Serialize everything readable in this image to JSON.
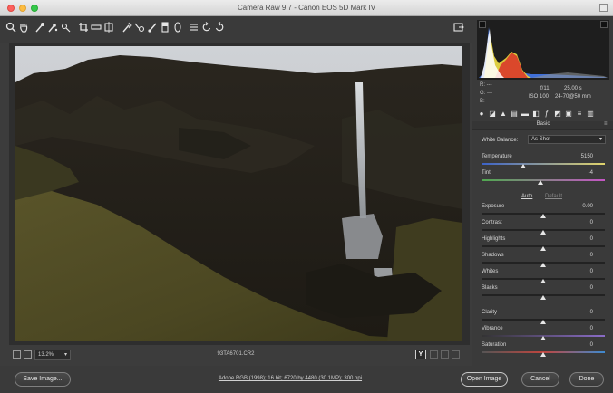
{
  "window": {
    "title": "Camera Raw 9.7  -  Canon EOS 5D Mark IV"
  },
  "toolbar": {
    "tools": [
      "zoom-icon",
      "hand-icon",
      "white-balance-icon",
      "color-sampler-icon",
      "target-adjust-icon",
      "crop-icon",
      "straighten-icon",
      "transform-icon",
      "spot-removal-icon",
      "red-eye-icon",
      "brush-icon",
      "graduated-filter-icon",
      "radial-filter-icon",
      "preferences-icon",
      "rotate-ccw-icon",
      "rotate-cw-icon"
    ],
    "fullscreen_icon": "fullscreen-icon"
  },
  "status": {
    "zoom": "13.2%",
    "filename": "93TA6701.CR2"
  },
  "bottom": {
    "save_label": "Save Image...",
    "workflow_link": "Adobe RGB (1998); 16 bit; 6720 by 4480 (30.1MP); 300 ppi",
    "open_label": "Open Image",
    "cancel_label": "Cancel",
    "done_label": "Done"
  },
  "meta": {
    "r_label": "R:",
    "g_label": "G:",
    "b_label": "B:",
    "rgb_placeholder": "---",
    "aperture": "f/11",
    "shutter": "25.00 s",
    "iso": "ISO 100",
    "lens": "24-70@50 mm"
  },
  "panel": {
    "title": "Basic",
    "white_balance_label": "White Balance:",
    "white_balance_value": "As Shot",
    "auto_label": "Auto",
    "default_label": "Default",
    "controls": [
      {
        "label": "Temperature",
        "value": "5150",
        "position": 0.34
      },
      {
        "label": "Tint",
        "value": "-4",
        "position": 0.48
      },
      {
        "label": "Exposure",
        "value": "0.00",
        "position": 0.5
      },
      {
        "label": "Contrast",
        "value": "0",
        "position": 0.5
      },
      {
        "label": "Highlights",
        "value": "0",
        "position": 0.5
      },
      {
        "label": "Shadows",
        "value": "0",
        "position": 0.5
      },
      {
        "label": "Whites",
        "value": "0",
        "position": 0.5
      },
      {
        "label": "Blacks",
        "value": "0",
        "position": 0.5
      },
      {
        "label": "Clarity",
        "value": "0",
        "position": 0.5
      },
      {
        "label": "Vibrance",
        "value": "0",
        "position": 0.5
      },
      {
        "label": "Saturation",
        "value": "0",
        "position": 0.5
      }
    ]
  },
  "colors": {
    "accent": "#e6e6e6",
    "panel_bg": "#3a3a3a",
    "histogram_yellow": "#e5d33b",
    "histogram_red": "#d93a2a",
    "histogram_blue": "#3f6fd8"
  }
}
